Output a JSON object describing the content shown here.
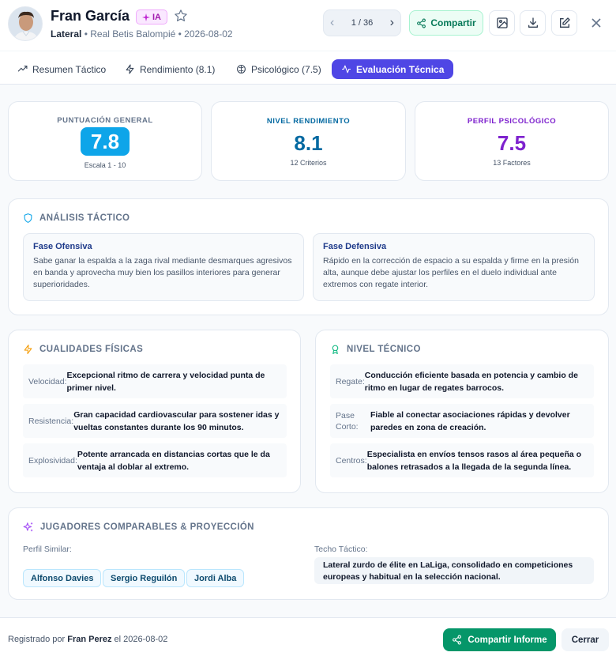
{
  "header": {
    "name": "Fran García",
    "ia_badge": "IA",
    "position": "Lateral",
    "club": "• Real Betis Balompié",
    "date": "• 2026-08-02",
    "pager": "1 / 36",
    "share_label": "Compartir"
  },
  "tabs": [
    {
      "label": "Resumen Táctico",
      "icon": "trending-up-icon"
    },
    {
      "label": "Rendimiento (8.1)",
      "icon": "lightning-icon"
    },
    {
      "label": "Psicológico (7.5)",
      "icon": "brain-icon"
    },
    {
      "label": "Evaluación Técnica",
      "icon": "activity-icon",
      "active": true
    }
  ],
  "scores": {
    "general": {
      "label": "PUNTUACIÓN GENERAL",
      "value": "7.8",
      "sub": "Escala 1 - 10",
      "color": "#0ea5e9"
    },
    "rendimiento": {
      "label": "NIVEL RENDIMIENTO",
      "value": "8.1",
      "sub": "12 Criterios",
      "color": "#0369a1"
    },
    "psicologico": {
      "label": "PERFIL PSICOLÓGICO",
      "value": "7.5",
      "sub": "13 Factores",
      "color": "#7e22ce"
    }
  },
  "tactico": {
    "title": "ANÁLISIS TÁCTICO",
    "ofensiva": {
      "title": "Fase Ofensiva",
      "text": "Sabe ganar la espalda a la zaga rival mediante desmarques agresivos en banda y aprovecha muy bien los pasillos interiores para generar superioridades."
    },
    "defensiva": {
      "title": "Fase Defensiva",
      "text": "Rápido en la corrección de espacio a su espalda y firme en la presión alta, aunque debe ajustar los perfiles en el duelo individual ante extremos con regate interior."
    }
  },
  "fisicas": {
    "title": "CUALIDADES FÍSICAS",
    "rows": [
      {
        "label": "Velocidad:",
        "value": "Excepcional ritmo de carrera y velocidad punta de primer nivel."
      },
      {
        "label": "Resistencia:",
        "value": "Gran capacidad cardiovascular para sostener idas y vueltas constantes durante los 90 minutos."
      },
      {
        "label": "Explosividad:",
        "value": "Potente arrancada en distancias cortas que le da ventaja al doblar al extremo."
      }
    ]
  },
  "tecnico": {
    "title": "NIVEL TÉCNICO",
    "rows": [
      {
        "label": "Regate:",
        "value": "Conducción eficiente basada en potencia y cambio de ritmo en lugar de regates barrocos."
      },
      {
        "label": "Pase Corto:",
        "value": "Fiable al conectar asociaciones rápidas y devolver paredes en zona de creación."
      },
      {
        "label": "Centros:",
        "value": "Especialista en envíos tensos rasos al área pequeña o balones retrasados a la llegada de la segunda línea."
      }
    ]
  },
  "comparables": {
    "title": "JUGADORES COMPARABLES & PROYECCIÓN",
    "similar_label": "Perfil Similar:",
    "players": [
      "Alfonso Davies",
      "Sergio Reguilón",
      "Jordi Alba"
    ],
    "ceiling_label": "Techo Táctico:",
    "ceiling_text": "Lateral zurdo de élite en LaLiga, consolidado en competiciones europeas y habitual en la selección nacional."
  },
  "footer": {
    "registered_prefix": "Registrado por",
    "registered_by": "Fran Perez",
    "registered_suffix": "el 2026-08-02",
    "share_label": "Compartir Informe",
    "close_label": "Cerrar"
  }
}
